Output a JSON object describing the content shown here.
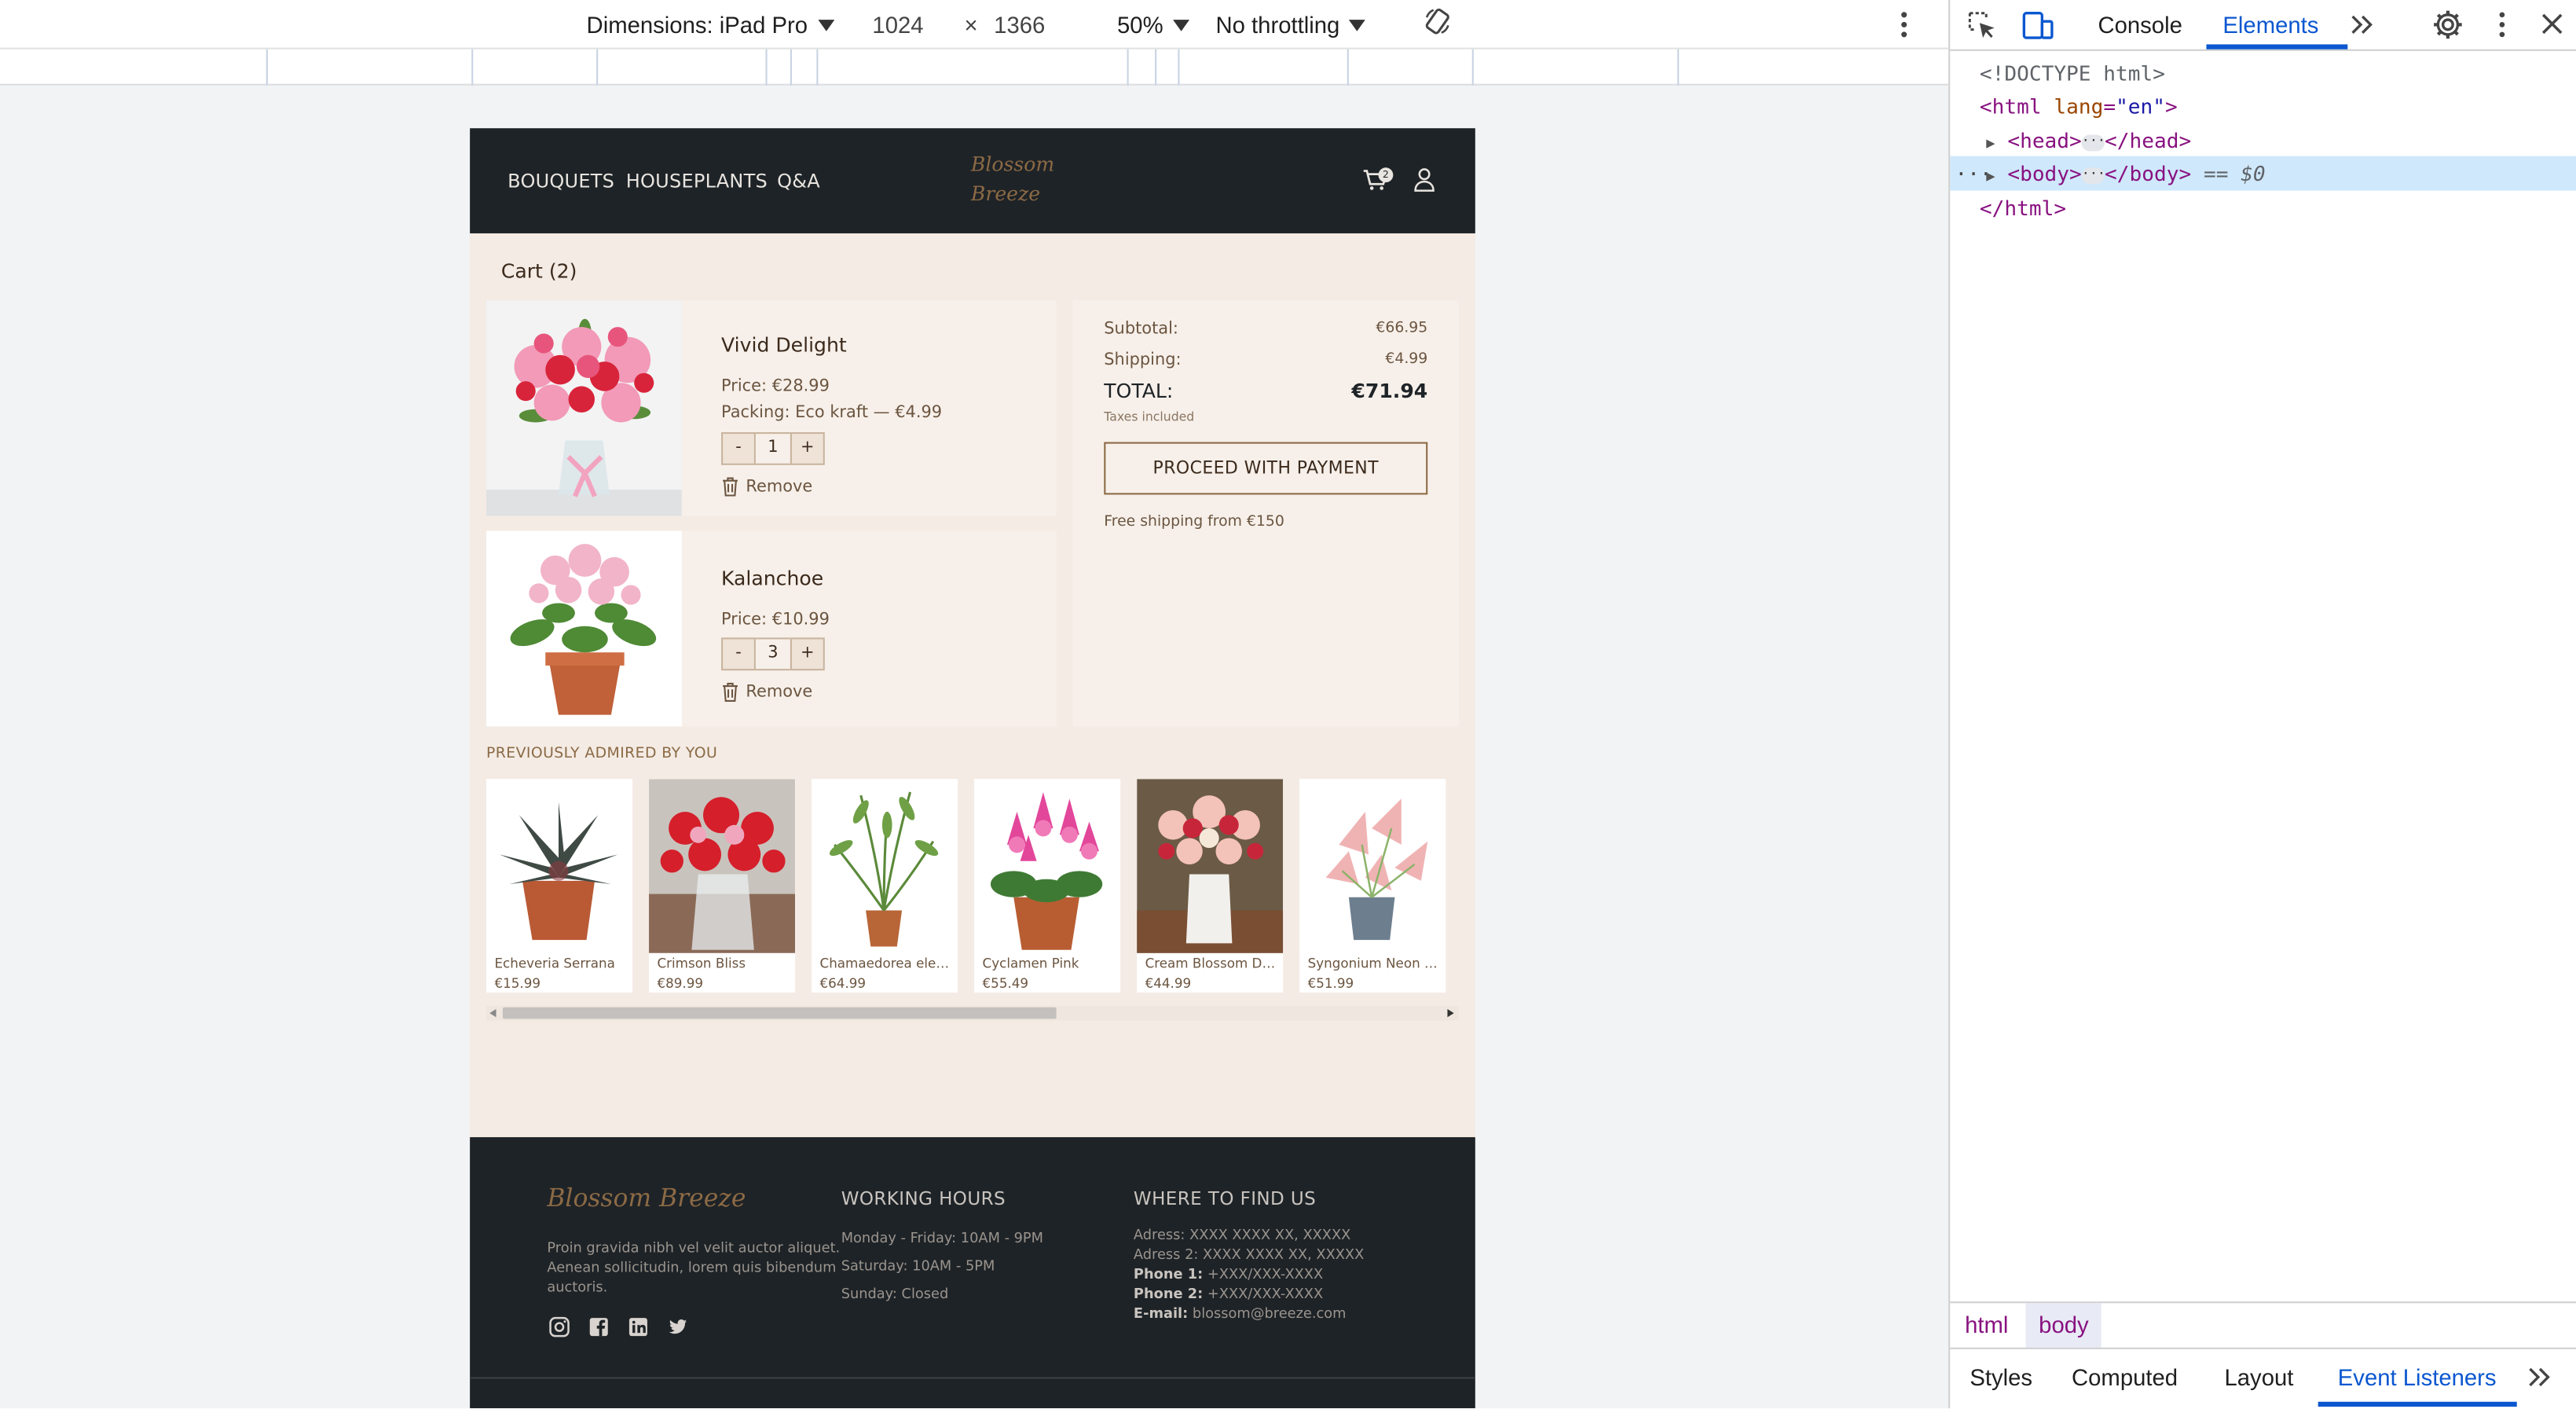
{
  "emulation": {
    "device_label": "Dimensions: iPad Pro",
    "width": "1024",
    "times": "×",
    "height": "1366",
    "zoom": "50%",
    "throttling": "No throttling"
  },
  "site": {
    "nav": [
      "BOUQUETS",
      "HOUSEPLANTS",
      "Q&A"
    ],
    "logo_line1": "Blossom",
    "logo_line2": "Breeze",
    "cart_count": "2"
  },
  "cart": {
    "title": "Cart (2)",
    "items": [
      {
        "name": "Vivid Delight",
        "price": "Price: €28.99",
        "packing": "Packing: Eco kraft — €4.99",
        "qty": "1",
        "minus": "-",
        "plus": "+",
        "remove": "Remove"
      },
      {
        "name": "Kalanchoe",
        "price": "Price: €10.99",
        "qty": "3",
        "minus": "-",
        "plus": "+",
        "remove": "Remove"
      }
    ]
  },
  "summary": {
    "subtotal_label": "Subtotal:",
    "subtotal": "€66.95",
    "shipping_label": "Shipping:",
    "shipping": "€4.99",
    "total_label": "TOTAL:",
    "total": "€71.94",
    "taxes": "Taxes included",
    "proceed": "PROCEED WITH PAYMENT",
    "free_shipping": "Free shipping from €150"
  },
  "previously": {
    "title": "PREVIOUSLY ADMIRED BY YOU",
    "items": [
      {
        "name": "Echeveria Serrana",
        "price": "€15.99"
      },
      {
        "name": "Crimson Bliss",
        "price": "€89.99"
      },
      {
        "name": "Chamaedorea elega...",
        "price": "€64.99"
      },
      {
        "name": "Cyclamen Pink",
        "price": "€55.49"
      },
      {
        "name": "Cream Blossom Del...",
        "price": "€44.99"
      },
      {
        "name": "Syngonium Neon Pi...",
        "price": "€51.99"
      }
    ],
    "scroll_fraction": 0.59
  },
  "footer": {
    "logo": "Blossom Breeze",
    "about_1": "Proin gravida nibh vel velit auctor aliquet.",
    "about_2": "Aenean sollicitudin, lorem quis bibendum",
    "about_3": "auctoris.",
    "hours_title": "WORKING HOURS",
    "hours": [
      "Monday - Friday: 10AM - 9PM",
      "Saturday: 10AM - 5PM",
      "Sunday: Closed"
    ],
    "find_title": "WHERE TO FIND US",
    "adress1": "Adress: XXXX XXXX XX, XXXXX",
    "adress2": "Adress 2: XXXX XXXX XX, XXXXX",
    "phone1_label": "Phone 1:",
    "phone1": "+XXX/XXX-XXXX",
    "phone2_label": "Phone 2:",
    "phone2": "+XXX/XXX-XXXX",
    "email_label": "E-mail:",
    "email": "blossom@breeze.com"
  },
  "devtools": {
    "tabs": [
      "Console",
      "Elements"
    ],
    "doctype": "<!DOCTYPE html>",
    "html_open": "<html",
    "lang_attr": "lang",
    "lang_val": "\"en\"",
    "head": "<head>",
    "head_close": "</head>",
    "body": "<body>",
    "body_close": "</body>",
    "eq": "== $0",
    "html_close": "</html>",
    "breadcrumbs": [
      "html",
      "body"
    ],
    "bottom_tabs": [
      "Styles",
      "Computed",
      "Layout",
      "Event Listeners"
    ],
    "colors": {
      "accent": "#0b57d0",
      "selected_row": "#cfe8fc"
    }
  }
}
